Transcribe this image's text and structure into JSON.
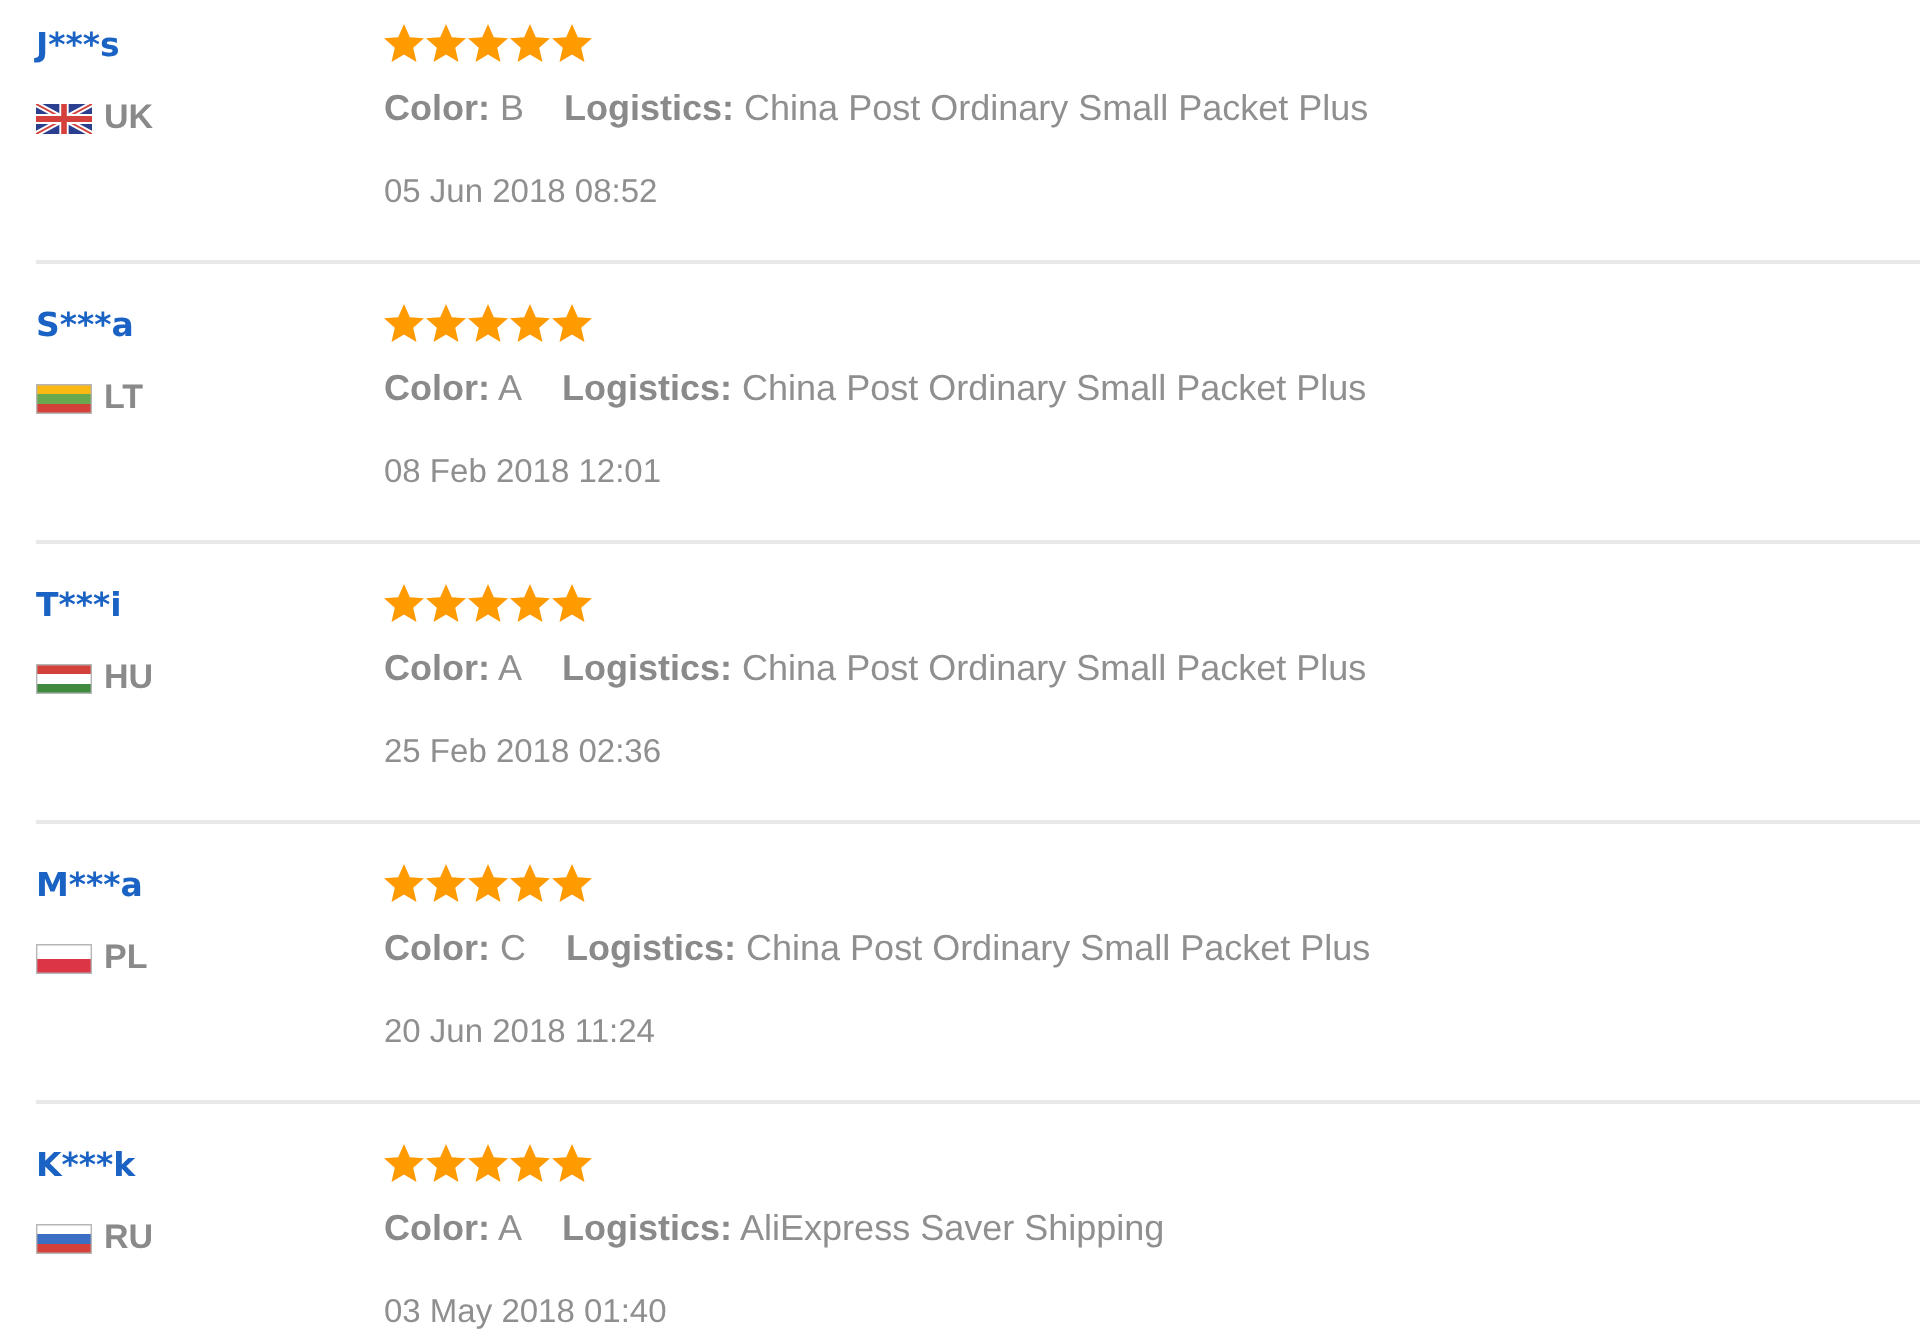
{
  "reviews": [
    {
      "name": "J***s",
      "country": "UK",
      "flag": {
        "kind": "union_jack"
      },
      "stars": 5,
      "attributes": [
        {
          "label": "Color:",
          "value": "B"
        },
        {
          "label": "Logistics:",
          "value": "China Post Ordinary Small Packet Plus"
        }
      ],
      "date": "05 Jun 2018 08:52"
    },
    {
      "name": "S***a",
      "country": "LT",
      "flag": {
        "kind": "stripes",
        "stripes": [
          {
            "color": "#fdb913"
          },
          {
            "color": "#6aa84f"
          },
          {
            "color": "#d4413b"
          }
        ]
      },
      "stars": 5,
      "attributes": [
        {
          "label": "Color:",
          "value": "A"
        },
        {
          "label": "Logistics:",
          "value": "China Post Ordinary Small Packet Plus"
        }
      ],
      "date": "08 Feb 2018 12:01"
    },
    {
      "name": "T***i",
      "country": "HU",
      "flag": {
        "kind": "stripes",
        "stripes": [
          {
            "color": "#d4413b"
          },
          {
            "color": "#ffffff"
          },
          {
            "color": "#3f8a3f"
          }
        ]
      },
      "stars": 5,
      "attributes": [
        {
          "label": "Color:",
          "value": "A"
        },
        {
          "label": "Logistics:",
          "value": "China Post Ordinary Small Packet Plus"
        }
      ],
      "date": "25 Feb 2018 02:36"
    },
    {
      "name": "M***a",
      "country": "PL",
      "flag": {
        "kind": "stripes",
        "stripes": [
          {
            "color": "#ffffff"
          },
          {
            "color": "#dc3545"
          }
        ]
      },
      "stars": 5,
      "attributes": [
        {
          "label": "Color:",
          "value": "C"
        },
        {
          "label": "Logistics:",
          "value": "China Post Ordinary Small Packet Plus"
        }
      ],
      "date": "20 Jun 2018 11:24"
    },
    {
      "name": "K***k",
      "country": "RU",
      "flag": {
        "kind": "stripes",
        "stripes": [
          {
            "color": "#ffffff"
          },
          {
            "color": "#3a6fc4"
          },
          {
            "color": "#d4413b"
          }
        ]
      },
      "stars": 5,
      "attributes": [
        {
          "label": "Color:",
          "value": "A"
        },
        {
          "label": "Logistics:",
          "value": "AliExpress Saver Shipping"
        }
      ],
      "date": "03 May 2018 01:40"
    }
  ]
}
